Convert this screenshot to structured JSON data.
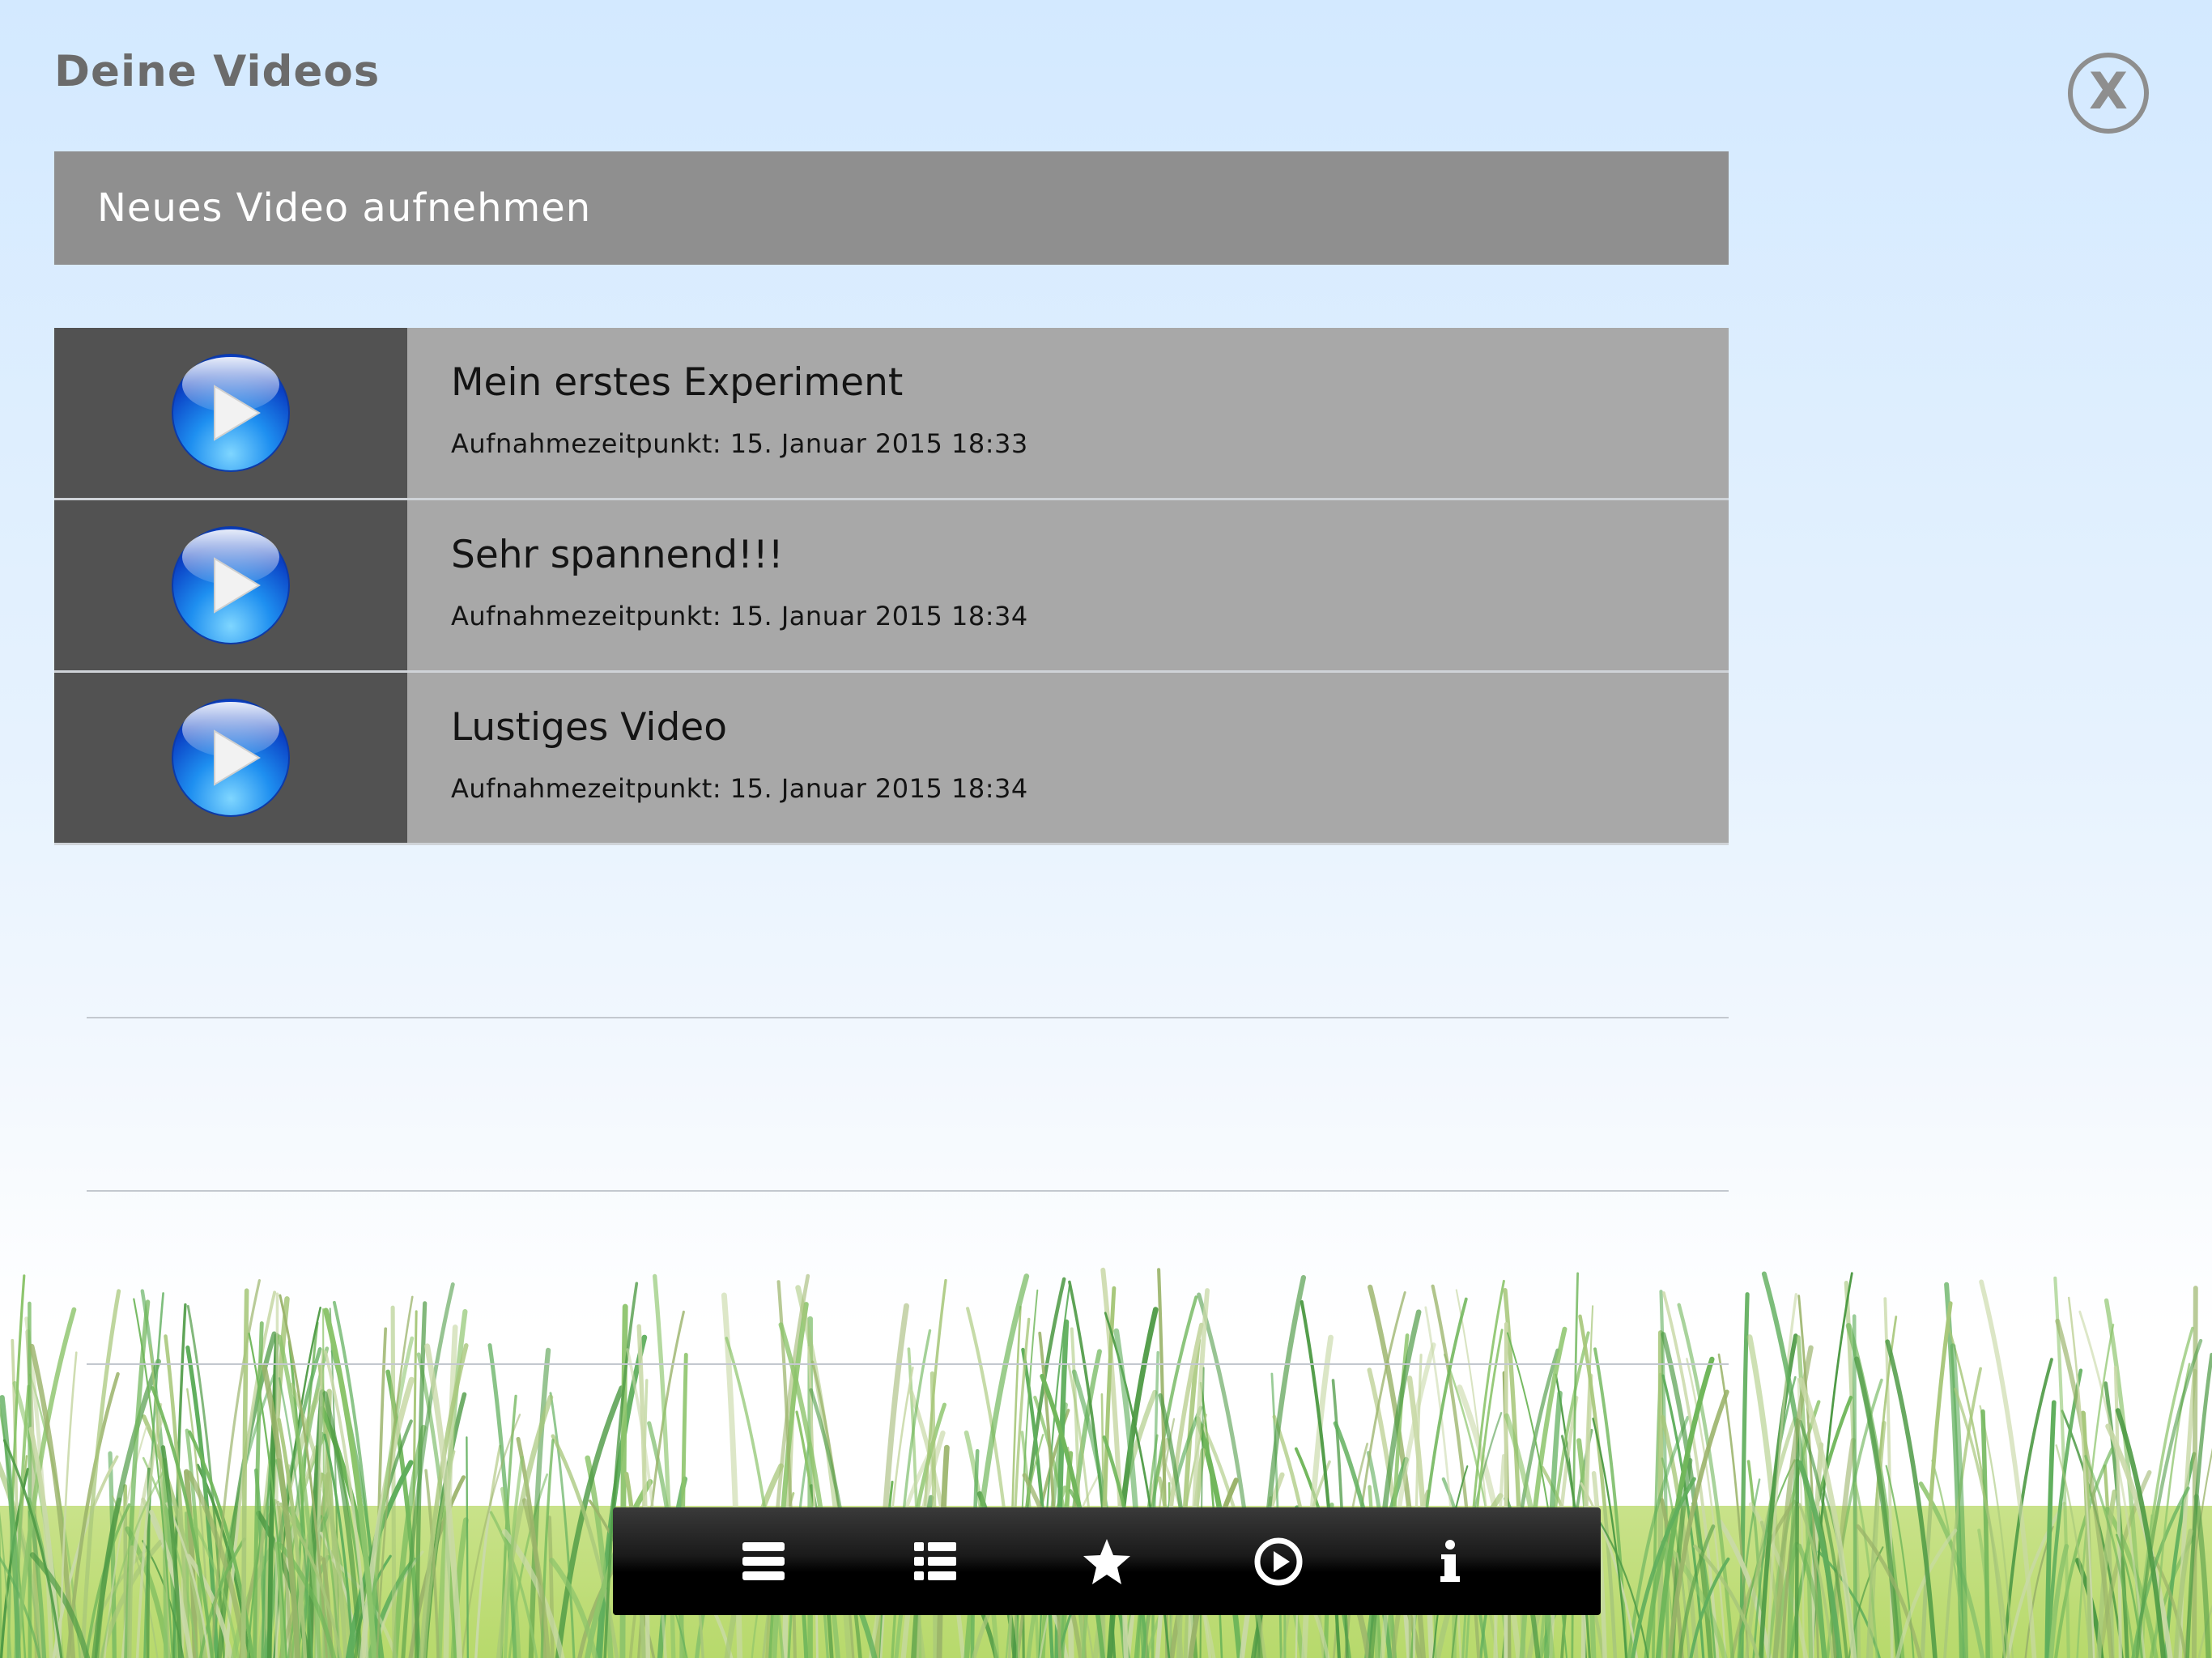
{
  "header": {
    "title": "Deine Videos",
    "close_label": "X"
  },
  "actions": {
    "new_video_label": "Neues Video aufnehmen"
  },
  "videos": [
    {
      "title": "Mein erstes Experiment",
      "recorded": "Aufnahmezeitpunkt: 15. Januar 2015 18:33"
    },
    {
      "title": "Sehr spannend!!!",
      "recorded": "Aufnahmezeitpunkt: 15. Januar 2015 18:34"
    },
    {
      "title": "Lustiges Video",
      "recorded": "Aufnahmezeitpunkt: 15. Januar 2015 18:34"
    }
  ],
  "tabbar": {
    "items": [
      {
        "icon": "menu-icon"
      },
      {
        "icon": "list-icon"
      },
      {
        "icon": "star-icon"
      },
      {
        "icon": "play-icon"
      },
      {
        "icon": "info-icon"
      }
    ]
  },
  "colors": {
    "title_gray": "#6b6b6b",
    "button_gray": "#8f8f8f",
    "thumb_dark": "#525252",
    "row_gray": "#a8a8a8",
    "play_blue": "#1e7fe6"
  }
}
